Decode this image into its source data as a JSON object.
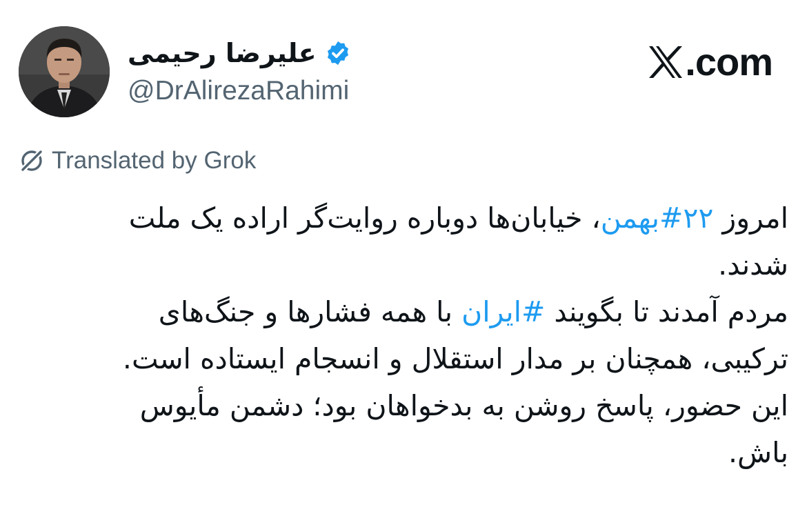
{
  "author": {
    "display_name": "علیرضا رحیمی",
    "handle": "@DrAlirezaRahimi",
    "verified": true,
    "verified_color": "#1d9bf0"
  },
  "site": {
    "logo_text": ".com",
    "logo_icon": "x-logo-icon"
  },
  "translation": {
    "label": "Translated by Grok",
    "icon": "grok-icon"
  },
  "tweet": {
    "hashtag_color": "#1d9bf0",
    "lines": [
      {
        "pre": "امروز ",
        "tag": "۲۲#بهمن",
        "post": "، خیابان‌ها دوباره روایت‌گر اراده یک ملت"
      },
      {
        "pre": "شدند.",
        "tag": "",
        "post": ""
      },
      {
        "pre": "مردم آمدند تا بگویند ",
        "tag": "#ایران",
        "post": " با همه فشارها و جنگ‌های"
      },
      {
        "pre": "ترکیبی، همچنان بر مدار استقلال و انسجام ایستاده است.",
        "tag": "",
        "post": ""
      },
      {
        "pre": "این حضور، پاسخ روشن به بدخواهان بود؛ دشمن مأیوس",
        "tag": "",
        "post": ""
      },
      {
        "pre": "باش.",
        "tag": "",
        "post": ""
      }
    ]
  }
}
